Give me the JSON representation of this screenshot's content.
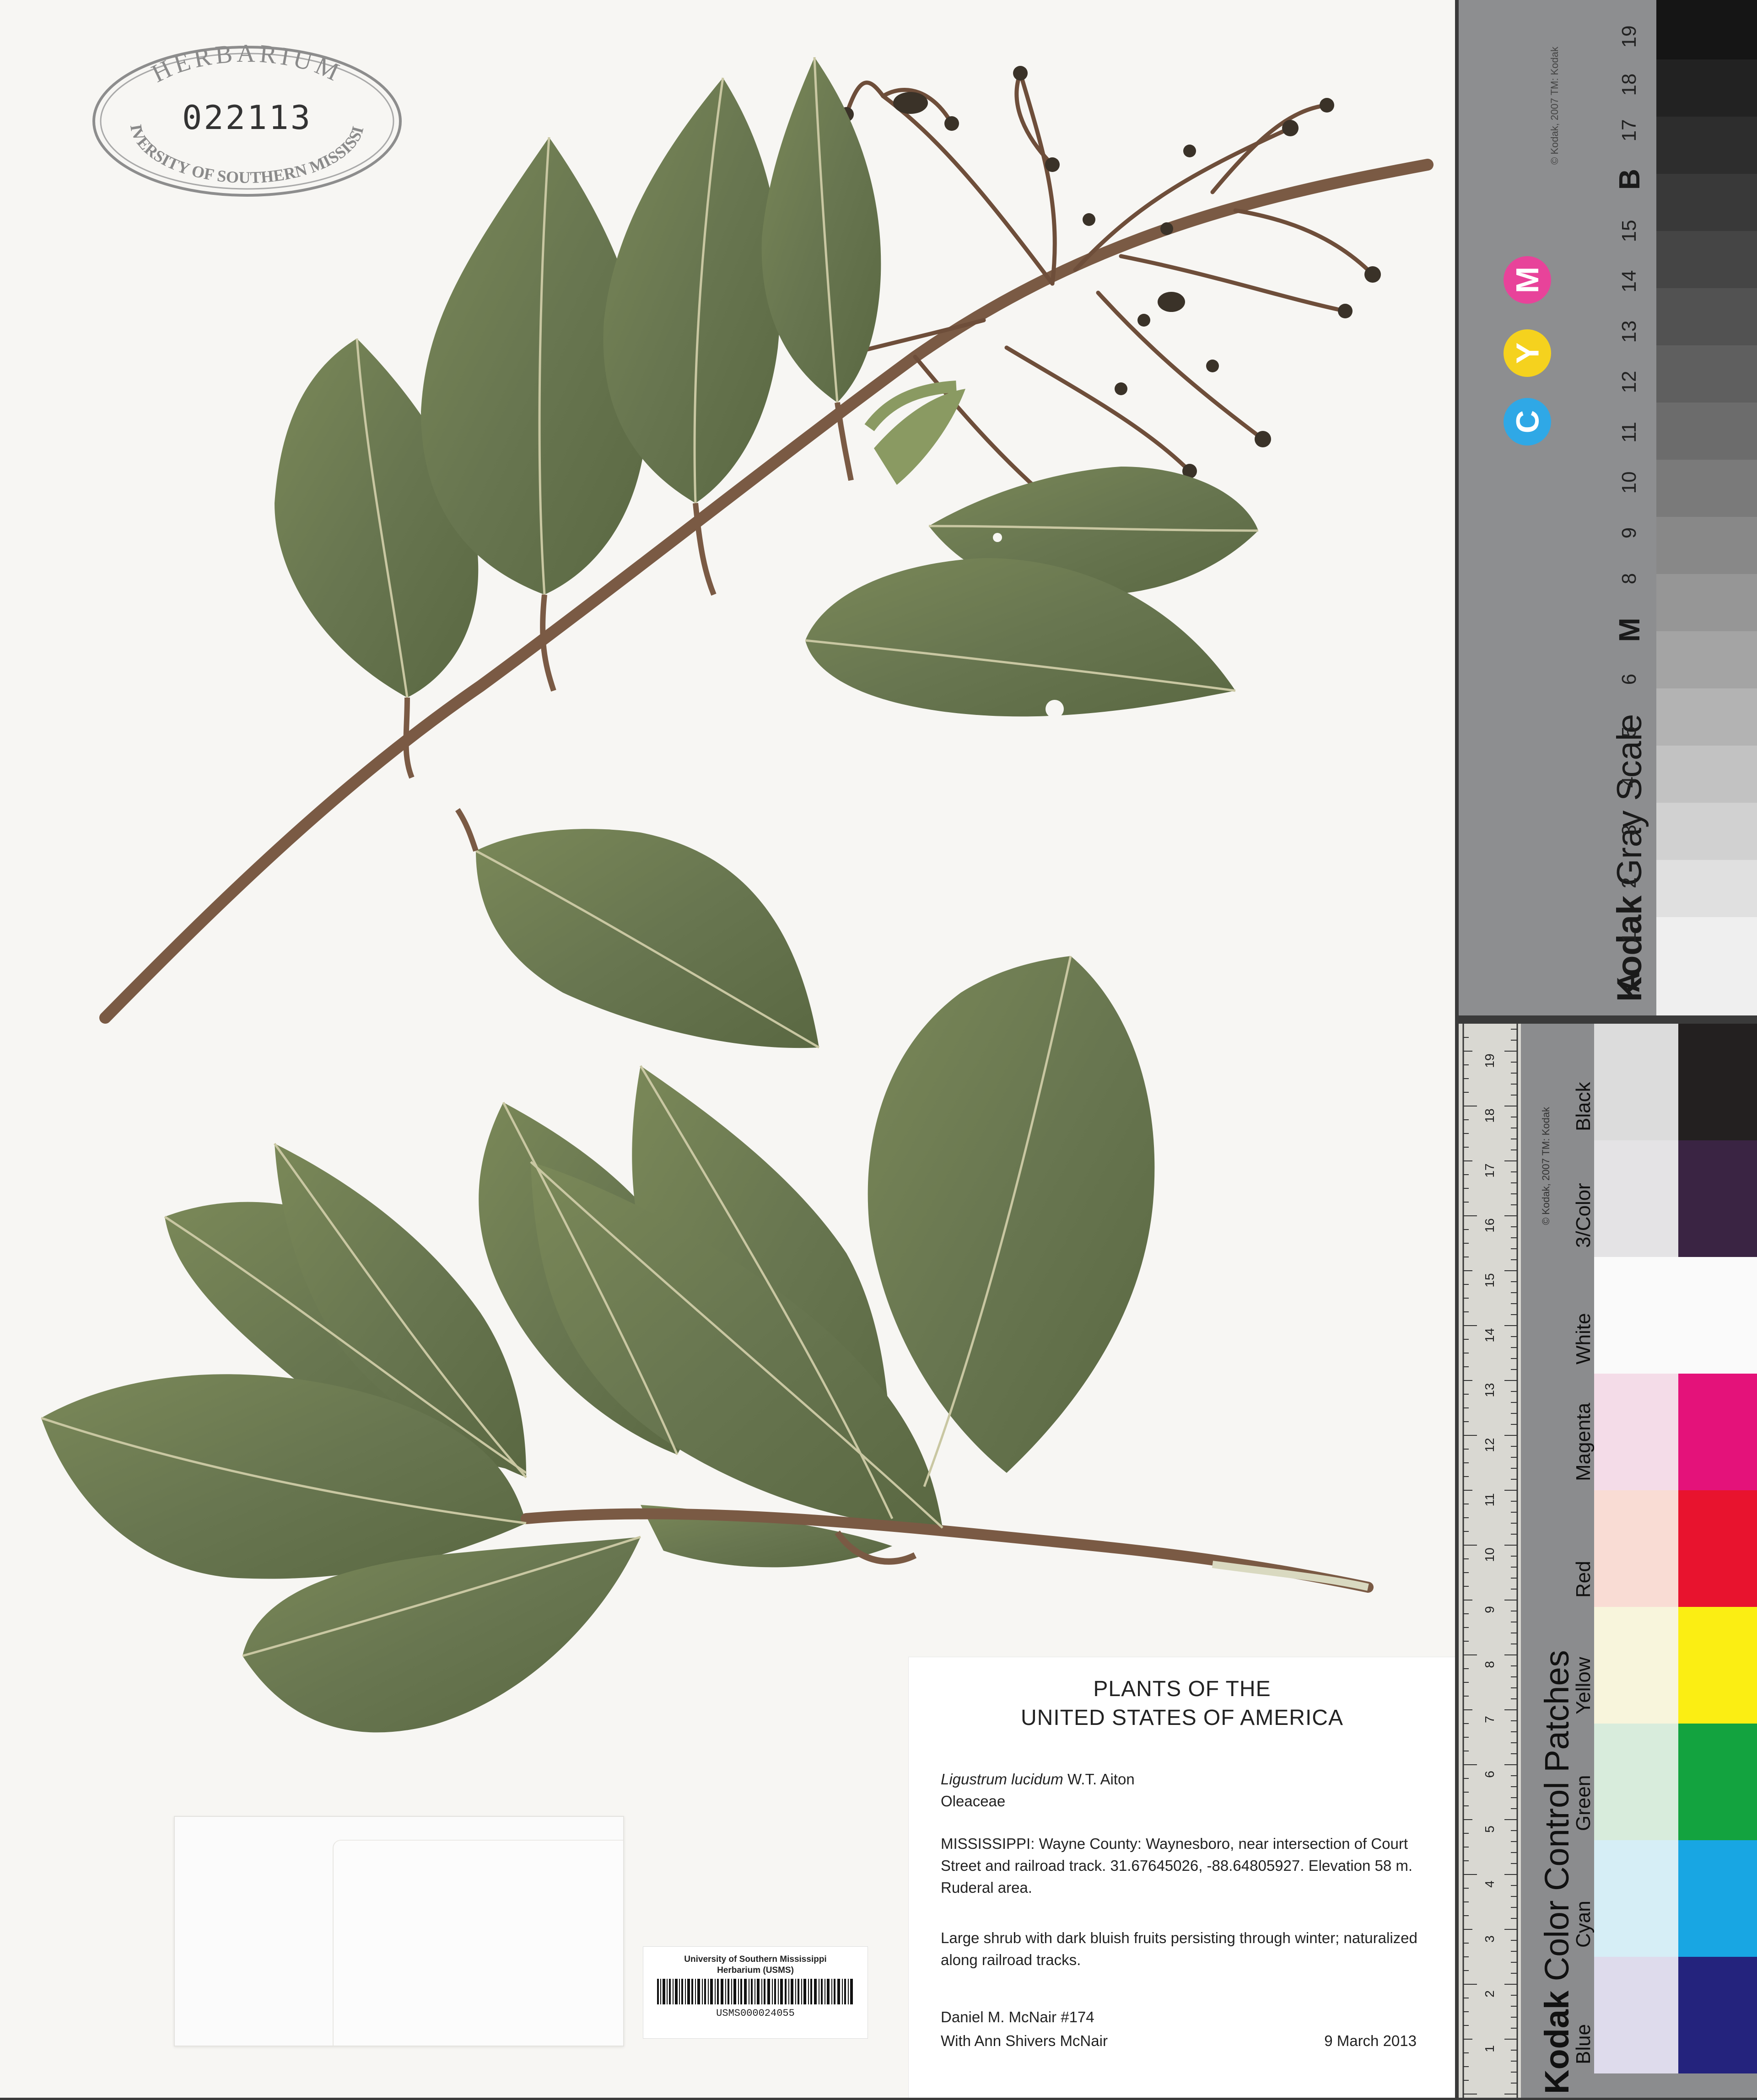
{
  "stamp": {
    "top_text": "HERBARIUM",
    "number": "022113",
    "bottom_text": "UNIVERSITY OF SOUTHERN MISSISSIPPI"
  },
  "label": {
    "title_line_1": "PLANTS OF THE",
    "title_line_2": "UNITED STATES OF AMERICA",
    "scientific_name": "Ligustrum lucidum",
    "author": "W.T. Aiton",
    "family": "Oleaceae",
    "locality": "MISSISSIPPI: Wayne County: Waynesboro, near intersection of Court Street and railroad track. 31.67645026, -88.64805927. Elevation 58 m. Ruderal area.",
    "description": "Large shrub with dark bluish fruits persisting through winter; naturalized along railroad tracks.",
    "collector": "Daniel M. McNair #174",
    "associates": "With Ann Shivers McNair",
    "date": "9 March 2013"
  },
  "barcode_label": {
    "line_1": "University of Southern Mississippi",
    "line_2": "Herbarium (USMS)",
    "catalog_number": "USMS000024055"
  },
  "gray_scale": {
    "brand": "Kodak",
    "title": "Gray Scale",
    "copyright": "© Kodak, 2007 TM: Kodak",
    "letters": [
      "A",
      "M",
      "B"
    ],
    "numbers": [
      "1",
      "2",
      "3",
      "4",
      "5",
      "6",
      "8",
      "9",
      "10",
      "11",
      "12",
      "13",
      "14",
      "15",
      "17",
      "18",
      "19"
    ],
    "cmy": [
      {
        "letter": "C",
        "color": "#2fa8e6"
      },
      {
        "letter": "Y",
        "color": "#f5d21e"
      },
      {
        "letter": "M",
        "color": "#e8439a"
      }
    ]
  },
  "color_card": {
    "brand": "Kodak",
    "title": "Color Control Patches",
    "copyright": "© Kodak, 2007 TM: Kodak",
    "ruler_unit_top": "inches",
    "ruler_unit_bottom": "cm",
    "ruler_numbers": [
      "1",
      "2",
      "3",
      "4",
      "5",
      "6",
      "7",
      "8",
      "9",
      "10",
      "11",
      "12",
      "13",
      "14",
      "15",
      "16",
      "17",
      "18",
      "19"
    ],
    "patches": [
      {
        "name": "Black",
        "light": "#dcdcdc",
        "dark": "#232020"
      },
      {
        "name": "3/Color",
        "light": "#e4e3e5",
        "dark": "#3a2443"
      },
      {
        "name": "White",
        "light": "#fafafa",
        "dark": "#fafafa"
      },
      {
        "name": "Magenta",
        "light": "#f4dce8",
        "dark": "#e4127a"
      },
      {
        "name": "Red",
        "light": "#f9dcd4",
        "dark": "#e8132e"
      },
      {
        "name": "Yellow",
        "light": "#f8f5dc",
        "dark": "#fbee13"
      },
      {
        "name": "Green",
        "light": "#d8ecdc",
        "dark": "#13a33f"
      },
      {
        "name": "Cyan",
        "light": "#d6eef6",
        "dark": "#18a6e3"
      },
      {
        "name": "Blue",
        "light": "#dedbec",
        "dark": "#24237d"
      }
    ]
  },
  "colors": {
    "leaf": "#6c7a4e",
    "leaf_dark": "#56643a",
    "stem": "#7a5a44",
    "sheet": "#f7f6f3"
  }
}
